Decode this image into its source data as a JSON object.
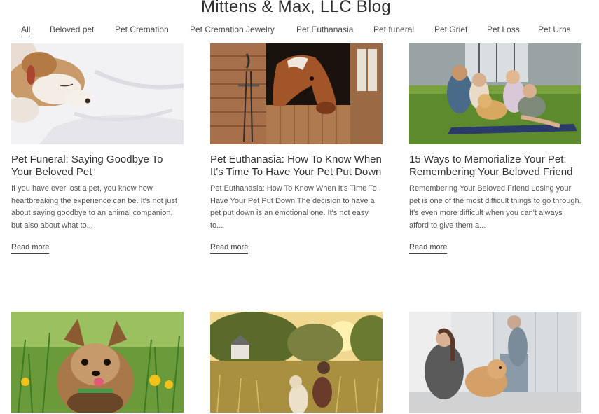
{
  "blog": {
    "title": "Mittens & Max, LLC Blog"
  },
  "nav": {
    "items": [
      {
        "label": "All",
        "active": true
      },
      {
        "label": "Beloved pet"
      },
      {
        "label": "Pet Cremation"
      },
      {
        "label": "Pet Cremation Jewelry"
      },
      {
        "label": "Pet Euthanasia"
      },
      {
        "label": "Pet funeral"
      },
      {
        "label": "Pet Grief"
      },
      {
        "label": "Pet Loss"
      },
      {
        "label": "Pet Urns"
      }
    ]
  },
  "posts": [
    {
      "title": "Pet Funeral: Saying Goodbye To Your Beloved Pet",
      "excerpt": "If you have ever lost a pet, you know how heartbreaking the experience can be. It's not just about saying goodbye to an animal companion, but also about what to...",
      "read_more": "Read more"
    },
    {
      "title": "Pet Euthanasia: How To Know When It's Time To Have Your Pet Put Down",
      "excerpt": "Pet Euthanasia: How To Know When It's Time To Have Your Pet Put Down The decision to have a pet put down is an emotional one. It's not easy to...",
      "read_more": "Read more"
    },
    {
      "title": "15 Ways to Memorialize Your Pet: Remembering Your Beloved Friend",
      "excerpt": "Remembering Your Beloved Friend Losing your pet is one of the most difficult things to go through. It's even more difficult when you can't always afford to give them a...",
      "read_more": "Read more"
    }
  ]
}
